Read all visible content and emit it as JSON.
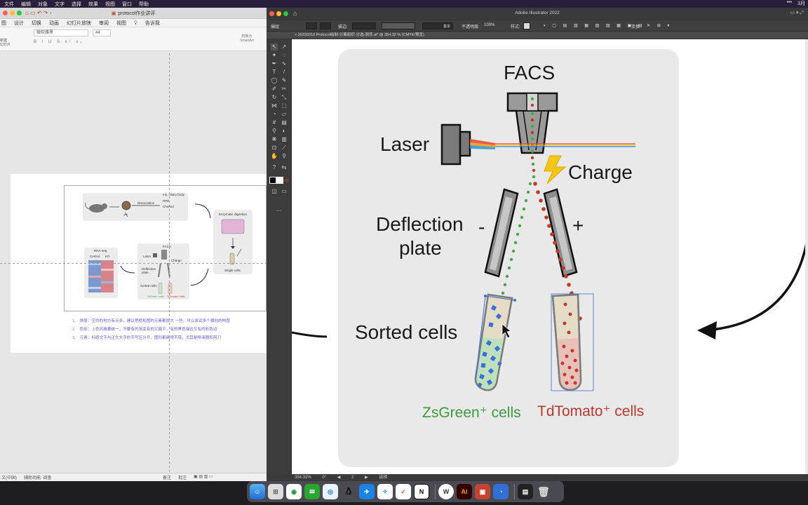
{
  "menubar": {
    "items": [
      "文件",
      "编辑",
      "对象",
      "文字",
      "选择",
      "效果",
      "视图",
      "窗口",
      "帮助"
    ],
    "right": [
      "•••",
      "3月"
    ]
  },
  "ppt": {
    "title": "protocol作业讲评",
    "tabs": [
      "图",
      "设计",
      "切换",
      "动画",
      "幻灯片放映",
      "审阅",
      "视图",
      "告诉我"
    ],
    "font_name": "微软雅黑",
    "font_size": "44",
    "ribbon_left": "新建\n幻灯片",
    "ribbon_right": "转换为\nSmartArt",
    "ribbon_format_row": "B I U S x² x₂",
    "slide": {
      "step_labels": {
        "dissociation": "Dissociation",
        "ciliary": "Iris, ciliary body",
        "rpe": "RPE",
        "choroid": "Choroid",
        "enzymatic": "Enzymatic digestion",
        "single_cells": "Single cells",
        "rnaseq": "RNA-seq",
        "control": "Control",
        "ko": "KO",
        "facs": "FACS",
        "laser": "Laser",
        "charge": "Charge",
        "deflection": "Deflection\nplate",
        "sorted": "Sorted cells",
        "zsgreen": "ZsGreen⁺ cells",
        "tdtomato": "TdTomato⁺ cells"
      },
      "notes": [
        {
          "num": "1.",
          "text": "排版：空白的地方有点多，建议把框和图的元素都放大 一些。可以尝试多个横向的构图"
        },
        {
          "num": "2.",
          "text": "色彩：上色风格要统一，不要有的渐变有的又扁平，有的黑色描边又有的彩色边"
        },
        {
          "num": "3.",
          "text": "元素：标题文字与正文文字的字号区分开，图形都画得不错，尤其是移液器和剪刀"
        }
      ]
    },
    "status": {
      "lang": "文(中国)",
      "accessibility": "辅助功能: 调查",
      "notes": "备注",
      "comments": "批注"
    }
  },
  "illustrator": {
    "title": "Adobe Illustrator 2022",
    "control_bar": {
      "selection": "编组",
      "stroke_label": "描边:",
      "stroke_value": "",
      "brush": "基本",
      "opacity_label": "不透明度:",
      "opacity_value": "100%",
      "style_label": "样式:",
      "transform": "变换"
    },
    "doc_tab": "× 20220319 Protocol绘制-分离组织-分选-测序.ai* @ 354.32 % (CMYK/预览)",
    "status": {
      "zoom": "354.32%",
      "rotation": "0°",
      "artboard": "2",
      "tool": "选择"
    },
    "artwork": {
      "facs": "FACS",
      "laser": "Laser",
      "charge": "Charge",
      "deflection_line1": "Deflection",
      "deflection_line2": "plate",
      "minus": "-",
      "plus": "+",
      "sorted_cells": "Sorted cells",
      "zsgreen": "ZsGreen⁺ cells",
      "tdtomato": "TdTomato⁺ cells",
      "colors": {
        "green": "#4aa84a",
        "red": "#c0392b",
        "blue": "#3a6fd8",
        "panel": "#e9e9e9"
      }
    }
  },
  "dock": {
    "apps": [
      "finder-icon",
      "launchpad-icon",
      "chrome-icon",
      "wechat-icon",
      "qq-browser-icon",
      "qq-icon",
      "mail-icon",
      "safari-icon",
      "reminders-icon",
      "notion-icon",
      "wps-icon",
      "illustrator-icon",
      "powerpoint-icon",
      "quicktime-icon",
      "document-icon",
      "trash-icon"
    ],
    "labels": {
      "illustrator": "Ai",
      "notion": "N",
      "wps": "W"
    }
  }
}
